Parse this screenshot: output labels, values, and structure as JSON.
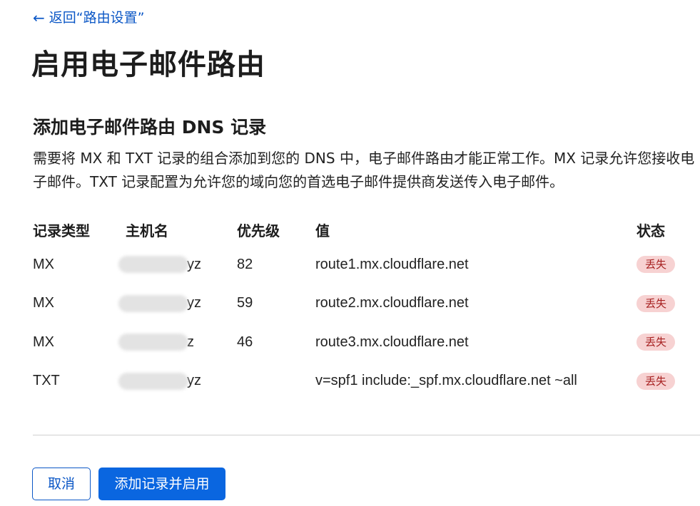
{
  "nav": {
    "back_arrow": "←",
    "back_label": "返回“路由设置”"
  },
  "page": {
    "title": "启用电子邮件路由"
  },
  "section": {
    "title": "添加电子邮件路由 DNS 记录",
    "description": "需要将 MX 和 TXT 记录的组合添加到您的 DNS 中，电子邮件路由才能正常工作。MX 记录允许您接收电子邮件。TXT 记录配置为允许您的域向您的首选电子邮件提供商发送传入电子邮件。"
  },
  "table": {
    "headers": {
      "type": "记录类型",
      "host": "主机名",
      "priority": "优先级",
      "value": "值",
      "status": "状态"
    },
    "rows": [
      {
        "type": "MX",
        "host_suffix": "yz",
        "priority": "82",
        "value": "route1.mx.cloudflare.net",
        "status": "丢失"
      },
      {
        "type": "MX",
        "host_suffix": "yz",
        "priority": "59",
        "value": "route2.mx.cloudflare.net",
        "status": "丢失"
      },
      {
        "type": "MX",
        "host_suffix": "z",
        "priority": "46",
        "value": "route3.mx.cloudflare.net",
        "status": "丢失"
      },
      {
        "type": "TXT",
        "host_suffix": "yz",
        "priority": "",
        "value": "v=spf1 include:_spf.mx.cloudflare.net ~all",
        "status": "丢失"
      }
    ]
  },
  "actions": {
    "cancel_label": "取消",
    "submit_label": "添加记录并启用"
  },
  "colors": {
    "link": "#0b57c6",
    "primary": "#0a66e0",
    "badge_bg": "#f7d2d2",
    "badge_text": "#a61f1f"
  }
}
